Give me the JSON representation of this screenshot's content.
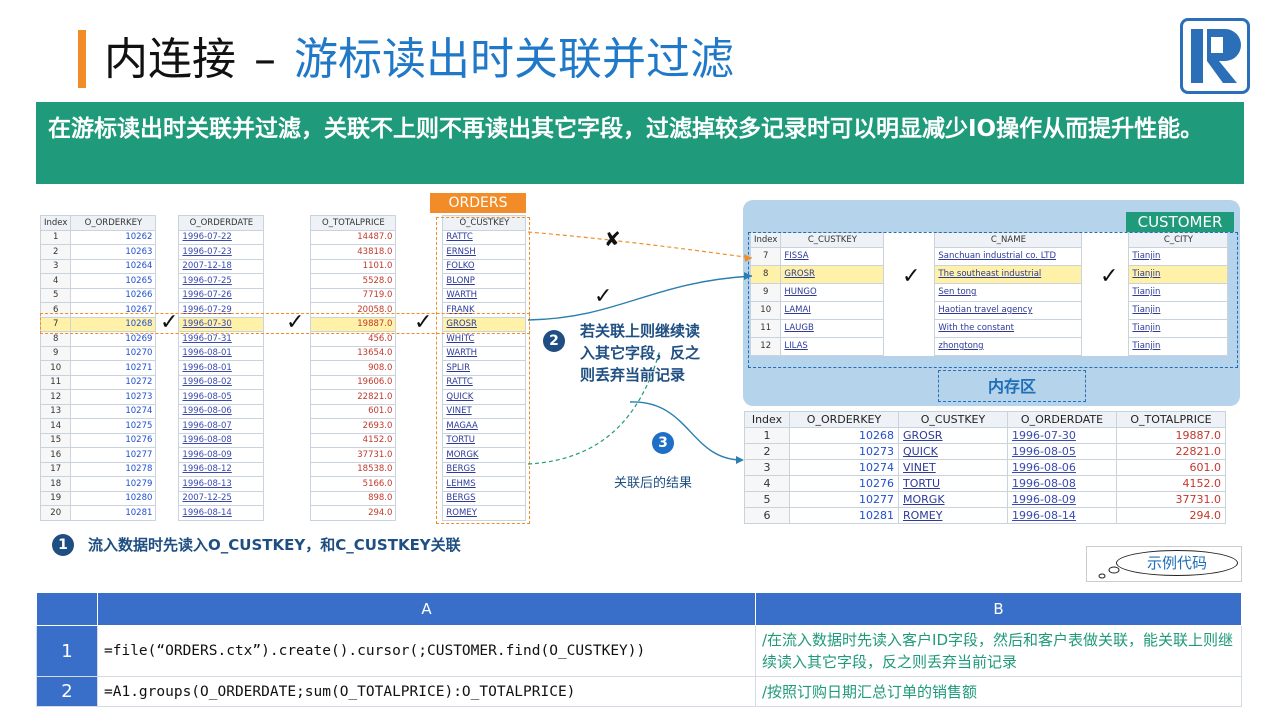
{
  "title": {
    "part1": "内连接",
    "dash": "–",
    "part2": "游标读出时关联并过滤"
  },
  "banner": "在游标读出时关联并过滤，关联不上则不再读出其它字段，过滤掉较多记录时可以明显减少IO操作从而提升性能。",
  "orders": {
    "label": "ORDERS",
    "headers": [
      "Index",
      "O_ORDERKEY",
      "O_ORDERDATE",
      "O_TOTALPRICE",
      "O_CUSTKEY"
    ],
    "rows": [
      [
        "1",
        "10262",
        "1996-07-22",
        "14487.0",
        "RATTC"
      ],
      [
        "2",
        "10263",
        "1996-07-23",
        "43818.0",
        "ERNSH"
      ],
      [
        "3",
        "10264",
        "2007-12-18",
        "1101.0",
        "FOLKO"
      ],
      [
        "4",
        "10265",
        "1996-07-25",
        "5528.0",
        "BLONP"
      ],
      [
        "5",
        "10266",
        "1996-07-26",
        "7719.0",
        "WARTH"
      ],
      [
        "6",
        "10267",
        "1996-07-29",
        "20058.0",
        "FRANK"
      ],
      [
        "7",
        "10268",
        "1996-07-30",
        "19887.0",
        "GROSR"
      ],
      [
        "8",
        "10269",
        "1996-07-31",
        "456.0",
        "WHITC"
      ],
      [
        "9",
        "10270",
        "1996-08-01",
        "13654.0",
        "WARTH"
      ],
      [
        "10",
        "10271",
        "1996-08-01",
        "908.0",
        "SPLIR"
      ],
      [
        "11",
        "10272",
        "1996-08-02",
        "19606.0",
        "RATTC"
      ],
      [
        "12",
        "10273",
        "1996-08-05",
        "22821.0",
        "QUICK"
      ],
      [
        "13",
        "10274",
        "1996-08-06",
        "601.0",
        "VINET"
      ],
      [
        "14",
        "10275",
        "1996-08-07",
        "2693.0",
        "MAGAA"
      ],
      [
        "15",
        "10276",
        "1996-08-08",
        "4152.0",
        "TORTU"
      ],
      [
        "16",
        "10277",
        "1996-08-09",
        "37731.0",
        "MORGK"
      ],
      [
        "17",
        "10278",
        "1996-08-12",
        "18538.0",
        "BERGS"
      ],
      [
        "18",
        "10279",
        "1996-08-13",
        "5166.0",
        "LEHMS"
      ],
      [
        "19",
        "10280",
        "2007-12-25",
        "898.0",
        "BERGS"
      ],
      [
        "20",
        "10281",
        "1996-08-14",
        "294.0",
        "ROMEY"
      ]
    ],
    "highlight_index": 6
  },
  "customer": {
    "label": "CUSTOMER",
    "headers": [
      "Index",
      "C_CUSTKEY",
      "C_NAME",
      "C_CITY"
    ],
    "rows": [
      [
        "7",
        "FISSA",
        "Sanchuan industrial co. LTD",
        "Tianjin"
      ],
      [
        "8",
        "GROSR",
        "The southeast industrial",
        "Tianjin"
      ],
      [
        "9",
        "HUNGO",
        "Sen tong",
        "Tianjin"
      ],
      [
        "10",
        "LAMAI",
        "Haotian travel agency",
        "Tianjin"
      ],
      [
        "11",
        "LAUGB",
        "With the constant",
        "Tianjin"
      ],
      [
        "12",
        "LILAS",
        "zhongtong",
        "Tianjin"
      ]
    ],
    "memory_label": "内存区"
  },
  "result": {
    "headers": [
      "Index",
      "O_ORDERKEY",
      "O_CUSTKEY",
      "O_ORDERDATE",
      "O_TOTALPRICE"
    ],
    "rows": [
      [
        "1",
        "10268",
        "GROSR",
        "1996-07-30",
        "19887.0"
      ],
      [
        "2",
        "10273",
        "QUICK",
        "1996-08-05",
        "22821.0"
      ],
      [
        "3",
        "10274",
        "VINET",
        "1996-08-06",
        "601.0"
      ],
      [
        "4",
        "10276",
        "TORTU",
        "1996-08-08",
        "4152.0"
      ],
      [
        "5",
        "10277",
        "MORGK",
        "1996-08-09",
        "37731.0"
      ],
      [
        "6",
        "10281",
        "ROMEY",
        "1996-08-14",
        "294.0"
      ]
    ]
  },
  "steps": {
    "s1_num": "1",
    "s1_text": "流入数据时先读入O_CUSTKEY，和C_CUSTKEY关联",
    "s2_num": "2",
    "s2_text_l1": "若关联上则继续读",
    "s2_text_l2": "入其它字段，反之",
    "s2_text_l3": "则丢弃当前记录",
    "s3_num": "3",
    "s3_text": "关联后的结果"
  },
  "marks": {
    "check": "✓",
    "cross": "✘"
  },
  "sample_code_label": "示例代码",
  "code": {
    "headers": [
      "",
      "A",
      "B"
    ],
    "rows": [
      {
        "n": "1",
        "a": "=file(“ORDERS.ctx”).create().cursor(;CUSTOMER.find(O_CUSTKEY))",
        "b": "/在流入数据时先读入客户ID字段，然后和客户表做关联，能关联上则继续读入其它字段，反之则丢弃当前记录"
      },
      {
        "n": "2",
        "a": "=A1.groups(O_ORDERDATE;sum(O_TOTALPRICE):O_TOTALPRICE)",
        "b": "/按照订购日期汇总订单的销售额"
      }
    ]
  },
  "colors": {
    "accent": "#f28c28",
    "banner": "#1f9a7a",
    "title_blue": "#1f78c8",
    "table_header": "#3a6fc9"
  }
}
